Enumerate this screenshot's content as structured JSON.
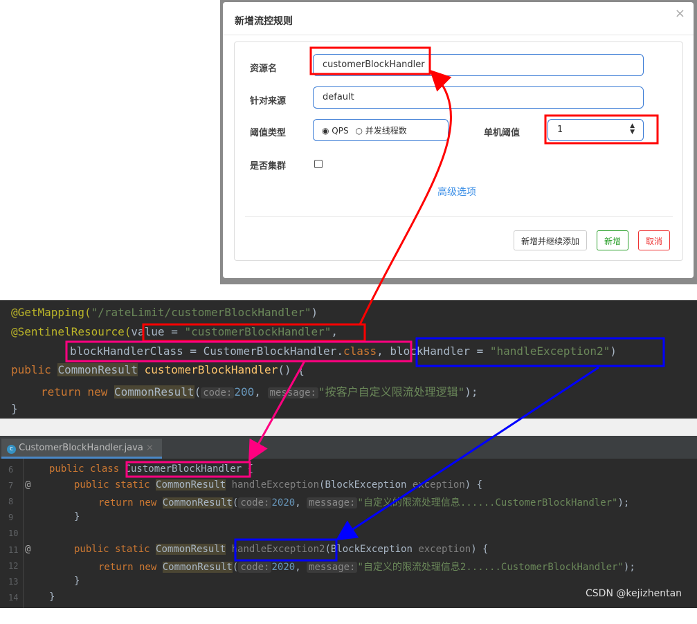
{
  "dialog": {
    "title": "新增流控规则",
    "close": "×",
    "resource_label": "资源名",
    "resource_value": "customerBlockHandler",
    "origin_label": "针对来源",
    "origin_value": "default",
    "threshold_type_label": "阈值类型",
    "radio_qps": "QPS",
    "radio_threads": "并发线程数",
    "qps_selected": true,
    "threshold_label": "单机阈值",
    "threshold_value": "1",
    "cluster_label": "是否集群",
    "cluster_checked": false,
    "advanced": "高级选项",
    "btn_add_continue": "新增并继续添加",
    "btn_add": "新增",
    "btn_cancel": "取消"
  },
  "code1": {
    "l1a": "@GetMapping(",
    "l1b": "\"/rateLimit/customerBlockHandler\"",
    "l1c": ")",
    "l2a": "@SentinelResource(",
    "l2b": "value = ",
    "l2c": "\"customerBlockHandler\"",
    "l2d": ",",
    "l3a": "blockHandlerClass = CustomerBlockHandler.",
    "l3b": "class",
    ", ": ", ",
    "l3c": "blockHandler = ",
    "l3d": "\"handleException2\"",
    "l3e": ")",
    "l4a": "public ",
    "l4b": "CommonResult",
    "l4c": " customerBlockHandler",
    "l4d": "() {",
    "l5a": "return new ",
    "l5b": "CommonResult",
    "l5c": "(",
    "h_code": "code:",
    "v200": "200",
    ",": ", ",
    "h_msg": "message:",
    "l5d": "\"按客户自定义限流处理逻辑\"",
    "l5e": ");",
    "l6": "}"
  },
  "code2": {
    "tab": "CustomerBlockHandler.java",
    "tab_close": "×",
    "lines": [
      "6",
      "7",
      "8",
      "9",
      "10",
      "11",
      "12",
      "13",
      "14"
    ],
    "public_class": "public class ",
    "cls": "CustomerBlockHandler",
    "brace": " {",
    "ps": "public static ",
    "cr": "CommonResult",
    "m1": " handleException",
    "m2": " handleException2",
    "params": "(BlockException ",
    "exc": "exception",
    "close": ") {",
    "rn": "return new ",
    "open": "(",
    "code": "code:",
    "v2020": "2020",
    ",": ", ",
    "msg": "message:",
    "s1": "\"自定义的限流处理信息......CustomerBlockHandler\"",
    "s2": "\"自定义的限流处理信息2......CustomerBlockHandler\"",
    "end": ");",
    "rb": "}",
    "at": "@"
  },
  "watermark": "CSDN @kejizhentan",
  "colors": {
    "red": "#ff0000",
    "pink": "#ff0080",
    "blue": "#0000ff"
  }
}
